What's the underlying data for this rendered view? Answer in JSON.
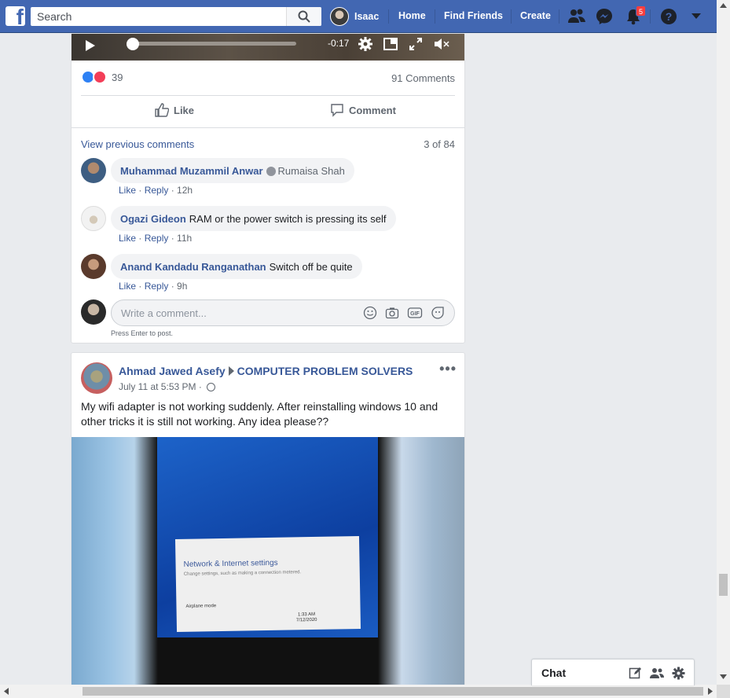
{
  "topbar": {
    "search_placeholder": "Search",
    "user_name": "Isaac",
    "nav_home": "Home",
    "nav_find_friends": "Find Friends",
    "nav_create": "Create",
    "notification_count": "5",
    "logo_letter": "f"
  },
  "video_post": {
    "time_remaining": "-0:17",
    "reaction_count": "39",
    "comment_count": "91 Comments",
    "like_label": "Like",
    "comment_label": "Comment",
    "view_previous": "View previous comments",
    "comments_position": "3 of 84",
    "comments": [
      {
        "author": "Muhammad Muzammil Anwar",
        "tag": "Rumaisa Shah",
        "text": "",
        "like": "Like",
        "reply": "Reply",
        "time": "12h"
      },
      {
        "author": "Ogazi Gideon",
        "tag": "",
        "text": "RAM or the power switch is pressing its self",
        "like": "Like",
        "reply": "Reply",
        "time": "11h"
      },
      {
        "author": "Anand Kandadu Ranganathan",
        "tag": "",
        "text": "Switch off be quite",
        "like": "Like",
        "reply": "Reply",
        "time": "9h"
      }
    ],
    "write_placeholder": "Write a comment...",
    "press_enter": "Press Enter to post."
  },
  "second_post": {
    "author": "Ahmad Jawed Asefy",
    "group": "COMPUTER PROBLEM SOLVERS",
    "timestamp": "July 11 at 5:53 PM",
    "more": "•••",
    "text": "My wifi adapter is not working suddenly. After reinstalling windows 10 and other tricks it is still not working. Any idea please??",
    "image": {
      "panel_title": "Network & Internet settings",
      "panel_subtitle": "Change settings, such as making a connection metered.",
      "airplane": "Airplane mode",
      "clock_time": "1:33 AM",
      "clock_date": "7/12/2020"
    }
  },
  "chat": {
    "label": "Chat"
  },
  "colors": {
    "brand": "#4267b2",
    "link": "#385898",
    "badge": "#fa3e3e"
  }
}
